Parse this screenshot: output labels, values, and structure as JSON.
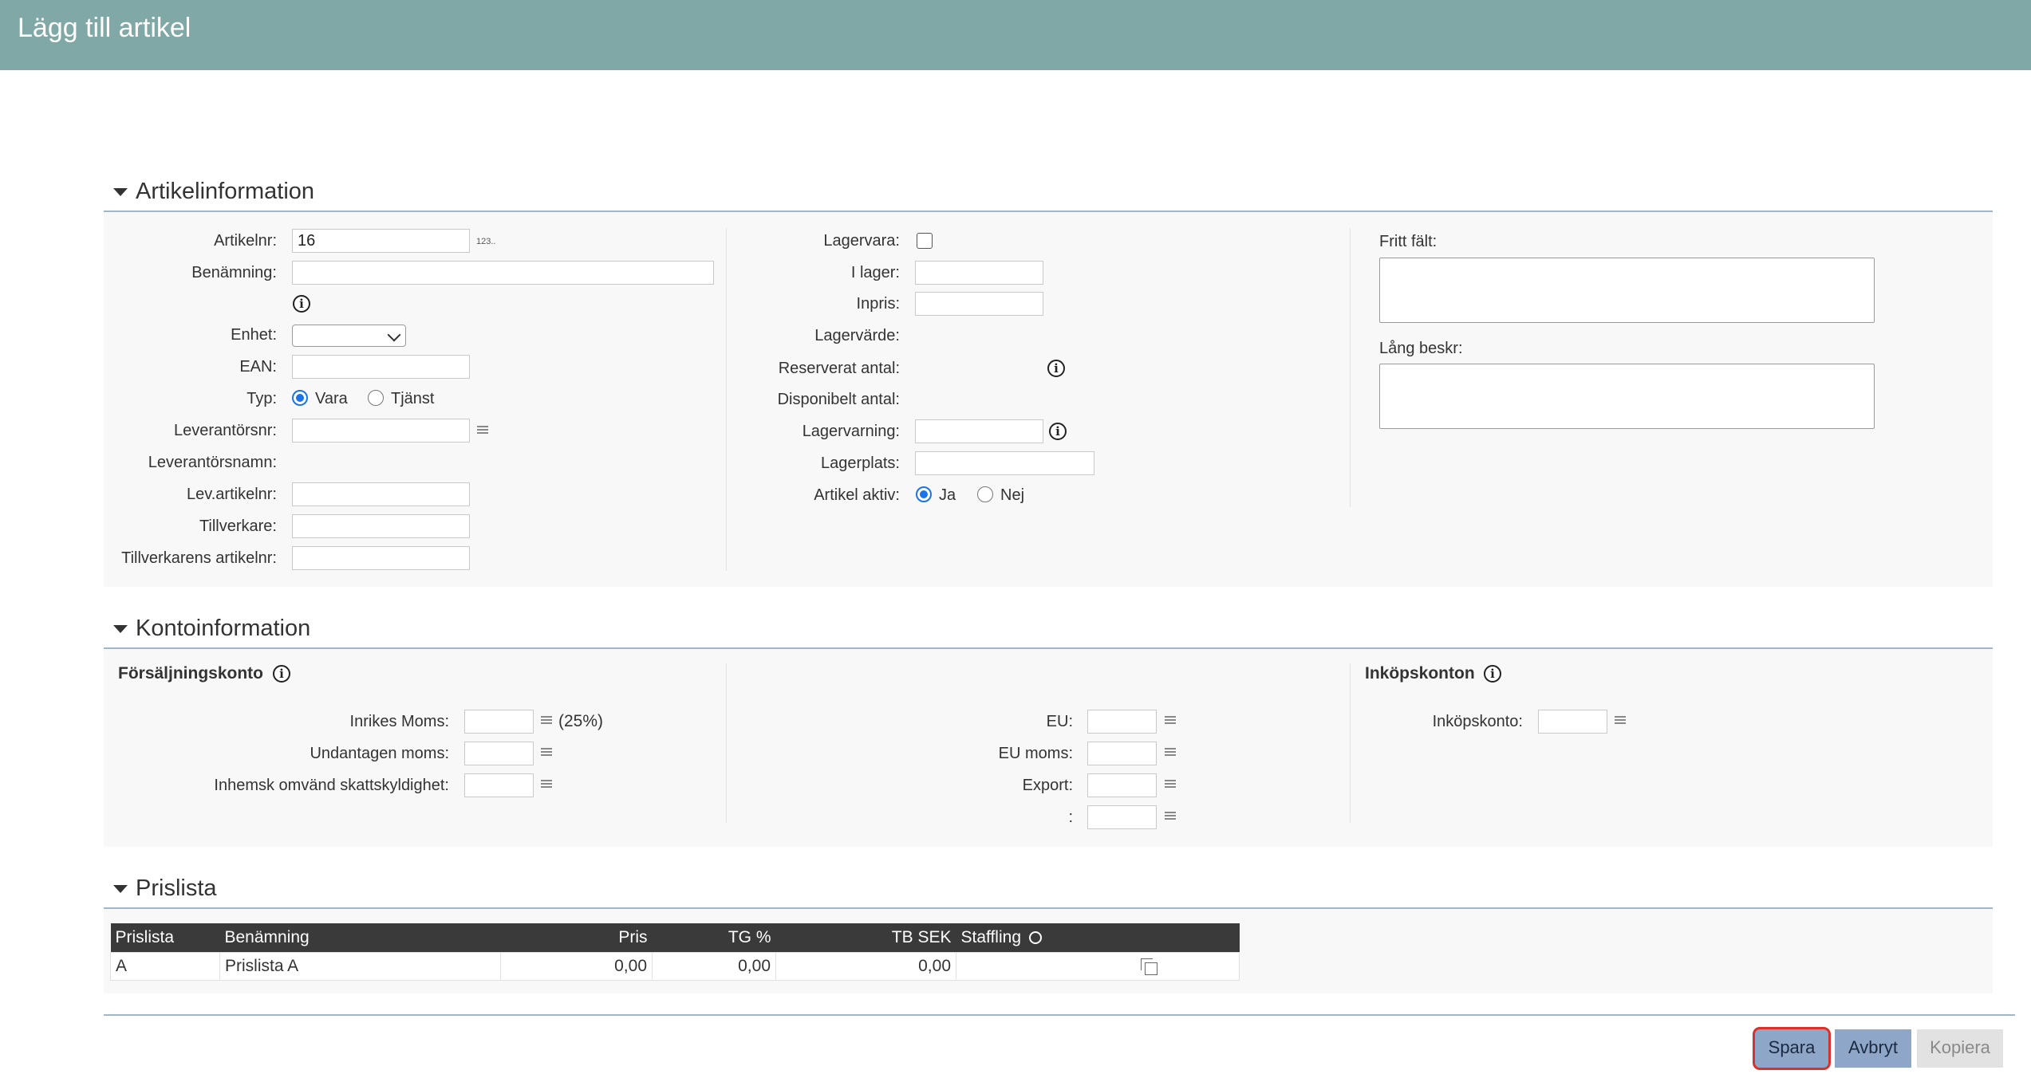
{
  "window": {
    "title": "Lägg till artikel"
  },
  "sections": {
    "artikel": "Artikelinformation",
    "konto": "Kontoinformation",
    "prislista": "Prislista"
  },
  "artikel": {
    "artikelnr_label": "Artikelnr:",
    "artikelnr_value": "16",
    "artikelnr_hint": "123..",
    "benamning_label": "Benämning:",
    "enhet_label": "Enhet:",
    "ean_label": "EAN:",
    "typ_label": "Typ:",
    "typ_vara": "Vara",
    "typ_tjanst": "Tjänst",
    "leverantorsnr_label": "Leverantörsnr:",
    "leverantorsnamn_label": "Leverantörsnamn:",
    "levartikelnr_label": "Lev.artikelnr:",
    "tillverkare_label": "Tillverkare:",
    "tillverkarens_artikelnr_label": "Tillverkarens artikelnr:",
    "lagervara_label": "Lagervara:",
    "ilager_label": "I lager:",
    "inpris_label": "Inpris:",
    "lagervarde_label": "Lagervärde:",
    "reserverat_label": "Reserverat antal:",
    "disponibelt_label": "Disponibelt antal:",
    "lagervarning_label": "Lagervarning:",
    "lagerplats_label": "Lagerplats:",
    "aktiv_label": "Artikel aktiv:",
    "aktiv_ja": "Ja",
    "aktiv_nej": "Nej",
    "fritt_falt_label": "Fritt fält:",
    "lang_beskr_label": "Lång beskr:"
  },
  "konto": {
    "forsaljning_title": "Försäljningskonto",
    "inrikes_label": "Inrikes Moms:",
    "inrikes_pct": "(25%)",
    "undantagen_label": "Undantagen moms:",
    "omvand_label": "Inhemsk omvänd skattskyldighet:",
    "eu_label": "EU:",
    "eumoms_label": "EU moms:",
    "export_label": "Export:",
    "blank_label": ":",
    "inkop_title": "Inköpskonton",
    "inkopskonto_label": "Inköpskonto:"
  },
  "prislista": {
    "columns": [
      "Prislista",
      "Benämning",
      "Pris",
      "TG %",
      "TB SEK",
      "Staffling"
    ],
    "rows": [
      {
        "prislista": "A",
        "benamning": "Prislista A",
        "pris": "0,00",
        "tg": "0,00",
        "tb": "0,00"
      }
    ]
  },
  "buttons": {
    "spara": "Spara",
    "avbryt": "Avbryt",
    "kopiera": "Kopiera"
  },
  "colors": {
    "header": "#7fa8a6",
    "accent": "#1a73e8",
    "focus_ring": "#d9312b"
  }
}
